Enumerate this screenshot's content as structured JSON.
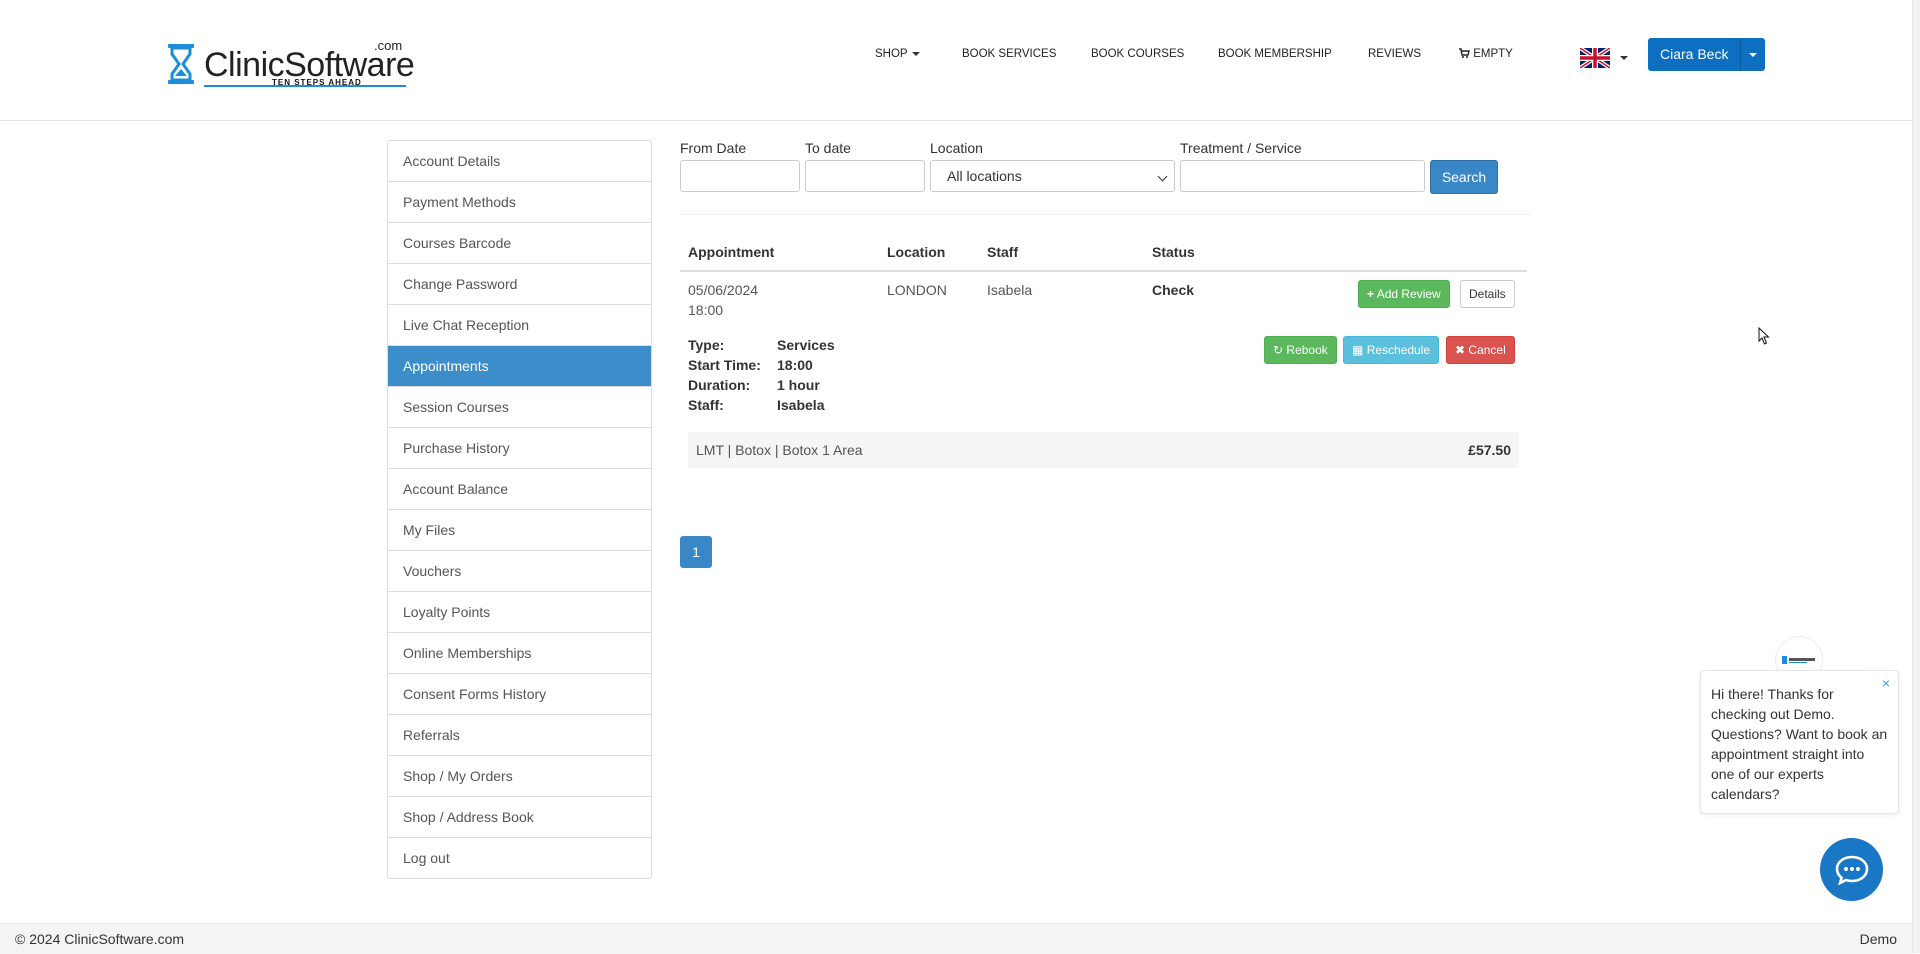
{
  "brand": {
    "name": "ClinicSoftware",
    "com": ".com",
    "tagline": "TEN STEPS AHEAD"
  },
  "nav": {
    "shop": "SHOP",
    "book_services": "BOOK SERVICES",
    "book_courses": "BOOK COURSES",
    "book_membership": "BOOK MEMBERSHIP",
    "reviews": "REVIEWS",
    "cart": "EMPTY",
    "user": "Ciara Beck",
    "language_icon": "uk-flag-icon"
  },
  "sidebar": {
    "items": [
      "Account Details",
      "Payment Methods",
      "Courses Barcode",
      "Change Password",
      "Live Chat Reception",
      "Appointments",
      "Session Courses",
      "Purchase History",
      "Account Balance",
      "My Files",
      "Vouchers",
      "Loyalty Points",
      "Online Memberships",
      "Consent Forms History",
      "Referrals",
      "Shop / My Orders",
      "Shop / Address Book",
      "Log out"
    ],
    "active": "Appointments"
  },
  "filters": {
    "from_label": "From Date",
    "from_value": "",
    "to_label": "To date",
    "to_value": "",
    "location_label": "Location",
    "location_value": "All locations",
    "service_label": "Treatment / Service",
    "service_value": "",
    "search_label": "Search"
  },
  "table": {
    "headers": [
      "Appointment",
      "Location",
      "Staff",
      "Status"
    ],
    "appointment": {
      "date": "05/06/2024",
      "time": "18:00",
      "location": "LONDON",
      "staff": "Isabela",
      "status": "Check",
      "add_review": "Add Review",
      "details": "Details",
      "rebook": "Rebook",
      "reschedule": "Reschedule",
      "cancel": "Cancel",
      "type_label": "Type:",
      "type_value": "Services",
      "start_label": "Start Time:",
      "start_value": "18:00",
      "duration_label": "Duration:",
      "duration_value": "1 hour",
      "staff_label": "Staff:",
      "staff_value": "Isabela",
      "service": "LMT | Botox | Botox 1 Area",
      "price": "£57.50"
    }
  },
  "pagination": {
    "current": "1"
  },
  "chat": {
    "message": "Hi there! Thanks for checking out Demo. Questions? Want to book an appointment straight into one of our experts calendars?",
    "close": "×"
  },
  "footer": {
    "copyright": "© 2024 ClinicSoftware.com",
    "right": "Demo"
  },
  "colors": {
    "primary": "#3d8dcb",
    "brand_blue": "#0e6fc1",
    "success": "#5cb85c",
    "info": "#5bc0de",
    "danger": "#d9534f"
  }
}
